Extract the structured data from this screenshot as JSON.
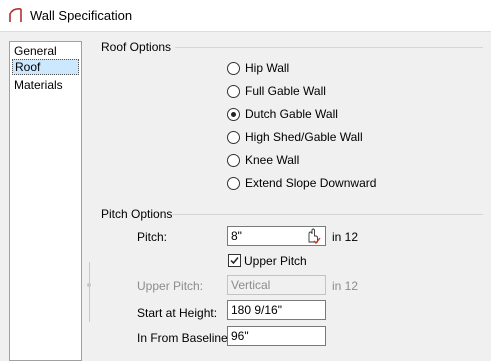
{
  "window": {
    "title": "Wall Specification",
    "icon": "roof-gable-icon"
  },
  "nav": {
    "items": [
      "General",
      "Roof",
      "Materials"
    ],
    "selected": "Roof"
  },
  "roof_options": {
    "label": "Roof Options",
    "options": [
      "Hip Wall",
      "Full Gable Wall",
      "Dutch Gable Wall",
      "High Shed/Gable Wall",
      "Knee Wall",
      "Extend Slope Downward"
    ],
    "selected": "Dutch Gable Wall"
  },
  "pitch_options": {
    "label": "Pitch Options",
    "pitch": {
      "label": "Pitch:",
      "value": "8\"",
      "unit": "in 12",
      "picker_icon": "hand-pointer-icon"
    },
    "upper_pitch_check": {
      "label": "Upper Pitch",
      "checked": true
    },
    "upper_pitch": {
      "label": "Upper Pitch:",
      "value": "Vertical",
      "unit": "in 12",
      "enabled": false
    },
    "start_height": {
      "label": "Start at Height:",
      "value": "180 9/16\""
    },
    "in_from_baseline": {
      "label": "In From Baseline:",
      "value": "96\""
    }
  },
  "colors": {
    "selection": "#cce8ff",
    "disabled_text": "#8c8c8c",
    "accent_red": "#c0392b"
  }
}
